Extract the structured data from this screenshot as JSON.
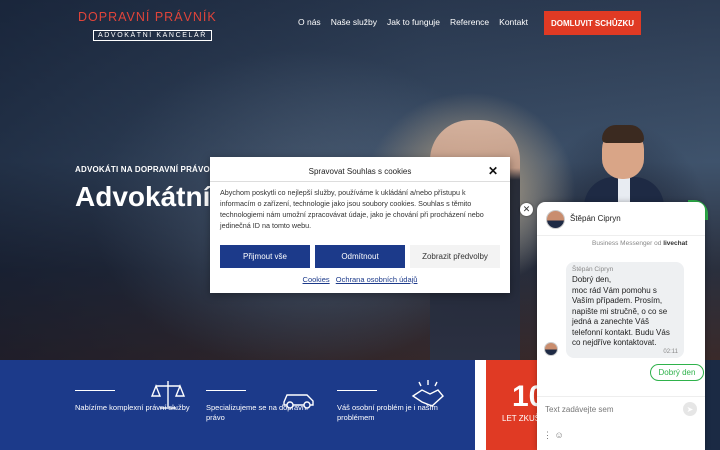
{
  "header": {
    "logo_main": "DOPRAVNÍ PRÁVNÍK",
    "logo_sub": "ADVOKÁTNÍ KANCELÁŘ",
    "nav": [
      "O nás",
      "Naše služby",
      "Jak to funguje",
      "Reference",
      "Kontakt"
    ],
    "cta": "DOMLUVIT SCHŮZKU"
  },
  "hero": {
    "kicker": "ADVOKÁTI NA DOPRAVNÍ PRÁVO",
    "headline": "Advokátní"
  },
  "features": [
    {
      "text": "Nabízíme komplexní právní služby",
      "icon": "scales-icon"
    },
    {
      "text": "Specializujeme se na dopravní právo",
      "icon": "car-icon"
    },
    {
      "text": "Váš osobní problém je i naším problémem",
      "icon": "handshake-icon"
    }
  ],
  "counter": {
    "number": "10",
    "label": "LET ZKUŠ"
  },
  "cookie_modal": {
    "title": "Spravovat Souhlas s cookies",
    "close": "✕",
    "body": "Abychom poskytli co nejlepší služby, používáme k ukládání a/nebo přístupu k informacím o zařízení, technologie jako jsou soubory cookies. Souhlas s těmito technologiemi nám umožní zpracovávat údaje, jako je chování při procházení nebo jedinečná ID na tomto webu.",
    "accept": "Přijmout vše",
    "reject": "Odmítnout",
    "preferences": "Zobrazit předvolby",
    "link_cookies": "Cookies",
    "link_privacy": "Ochrana osobních údajů"
  },
  "chat": {
    "agent_name": "Štěpán Cipryn",
    "powered_prefix": "Business Messenger od",
    "powered_brand": "livechat",
    "bubble_name": "Štěpán Cipryn",
    "message": "Dobrý den,\nmoc rád Vám pomohu s Vaším případem. Prosím, napište mi stručně, o co se jedná a zanechte Váš telefonní kontakt. Budu Vás co nejdříve kontaktovat.",
    "time": "02:11",
    "quick_reply": "Dobrý den",
    "input_placeholder": "Text zadávejte sem",
    "close": "✕"
  },
  "colors": {
    "accent_red": "#e03a24",
    "brand_blue": "#1c3a8a",
    "chat_green": "#2fb24b"
  }
}
